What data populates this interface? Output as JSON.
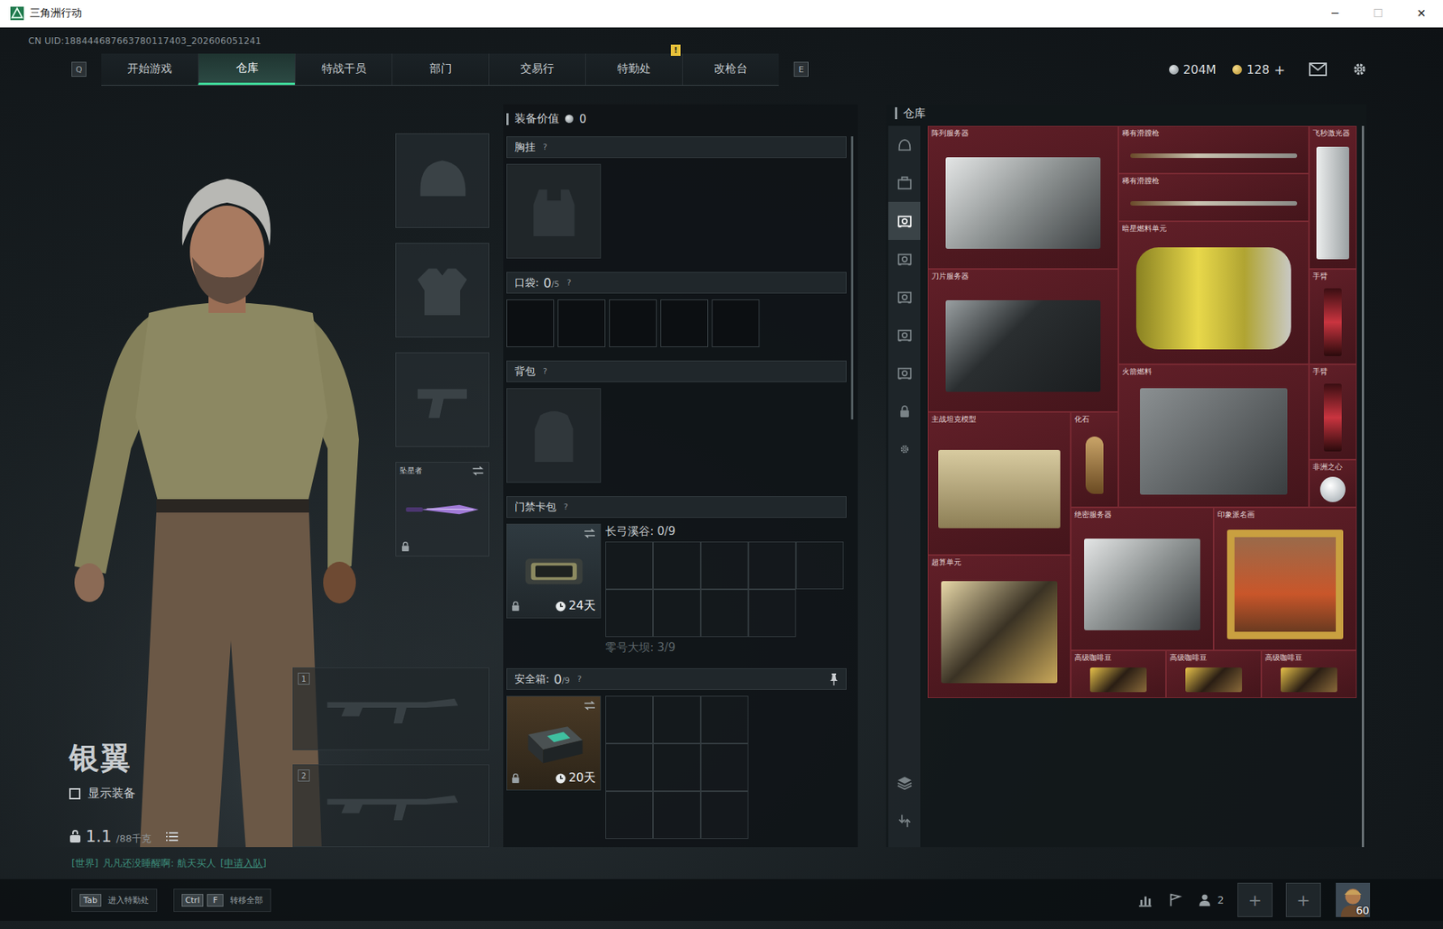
{
  "window": {
    "title": "三角洲行动",
    "controls": [
      "─",
      "☐",
      "✕"
    ]
  },
  "uid": "CN UID:188444687663780117403_202606051241",
  "nav": {
    "prev_key": "Q",
    "next_key": "E",
    "tabs": [
      {
        "label": "开始游戏",
        "selected": false
      },
      {
        "label": "仓库",
        "selected": true
      },
      {
        "label": "特战干员",
        "selected": false
      },
      {
        "label": "部门",
        "selected": false
      },
      {
        "label": "交易行",
        "selected": false
      },
      {
        "label": "特勤处",
        "selected": false,
        "badge": "!"
      },
      {
        "label": "改枪台",
        "selected": false
      }
    ]
  },
  "currency": [
    {
      "kind": "silver",
      "amount": "204M"
    },
    {
      "kind": "gold",
      "amount": "128",
      "action": "+"
    }
  ],
  "operator": {
    "name": "银翼",
    "show_gear": {
      "label": "显示装备",
      "checked": false
    },
    "weight": "1.1",
    "capacity": "/88千克"
  },
  "equipment": [
    {
      "kind": "helmet"
    },
    {
      "kind": "armor"
    },
    {
      "kind": "pistol"
    },
    {
      "kind": "melee",
      "label": "坠星者",
      "locked": true
    }
  ],
  "weapons": [
    {
      "number": "1"
    },
    {
      "number": "2"
    }
  ],
  "loadout": {
    "value_label": "装备价值",
    "value": "0",
    "chest_rig": {
      "title": "胸挂",
      "help": "?"
    },
    "pockets": {
      "title": "口袋:",
      "count": "0",
      "capacity": "/5",
      "help": "?",
      "slots": [
        {
          "filled": false
        },
        {
          "filled": false
        },
        {
          "filled": false
        },
        {
          "filled": false
        },
        {
          "filled": false
        }
      ]
    },
    "backpack": {
      "title": "背包",
      "help": "?"
    },
    "keycard": {
      "title": "门禁卡包",
      "help": "?",
      "item": {
        "time": "24天",
        "locked": true
      },
      "maps": [
        {
          "label": "长弓溪谷: 0/9",
          "active": true
        },
        {
          "label": "零号大坝: 3/9",
          "active": false
        }
      ],
      "grid": [
        {
          "filled": false
        },
        {
          "filled": false
        },
        {
          "filled": false
        },
        {
          "filled": false
        },
        {
          "filled": false
        },
        {
          "filled": false
        },
        {
          "filled": false
        },
        {
          "filled": false
        },
        {
          "filled": false
        }
      ]
    },
    "safebox": {
      "title": "安全箱:",
      "count": "0",
      "capacity": "/9",
      "help": "?",
      "item": {
        "time": "20天",
        "locked": true
      },
      "grid": [
        {
          "filled": false
        },
        {
          "filled": false
        },
        {
          "filled": false
        },
        {
          "filled": false
        },
        {
          "filled": false
        },
        {
          "filled": false
        },
        {
          "filled": false
        },
        {
          "filled": false
        },
        {
          "filled": false
        }
      ]
    }
  },
  "warehouse": {
    "title": "仓库",
    "side_tabs": [
      {
        "kind": "all",
        "selected": false
      },
      {
        "kind": "case",
        "selected": false
      },
      {
        "kind": "storage",
        "selected": true
      },
      {
        "kind": "storage",
        "selected": false
      },
      {
        "kind": "storage",
        "selected": false
      },
      {
        "kind": "storage",
        "selected": false
      },
      {
        "kind": "storage",
        "selected": false
      },
      {
        "kind": "locked",
        "selected": false
      },
      {
        "kind": "settings",
        "selected": false
      }
    ],
    "tools": [
      {
        "kind": "stack"
      },
      {
        "kind": "transfer"
      }
    ],
    "items": [
      {
        "name": "阵列服务器"
      },
      {
        "name": "稀有滑膛枪"
      },
      {
        "name": "稀有滑膛枪"
      },
      {
        "name": "飞秒激光器"
      },
      {
        "name": "暗星燃料单元"
      },
      {
        "name": "刀片服务器"
      },
      {
        "name": "手臂"
      },
      {
        "name": "手臂"
      },
      {
        "name": "火箭燃料"
      },
      {
        "name": "主战坦克模型"
      },
      {
        "name": "化石"
      },
      {
        "name": "非洲之心"
      },
      {
        "name": "绝密服务器"
      },
      {
        "name": "印象派名画"
      },
      {
        "name": "超算单元"
      },
      {
        "name": "高级咖啡豆"
      },
      {
        "name": "高级咖啡豆"
      },
      {
        "name": "高级咖啡豆"
      }
    ]
  },
  "chat": {
    "channel": "[世界]",
    "message": "凡凡还没睡醒啊: 航天买人",
    "action": "[申请入队]"
  },
  "bottom_bar": {
    "hints": [
      {
        "keys": [
          "Tab"
        ],
        "label": "进入特勤处"
      },
      {
        "keys": [
          "Ctrl",
          "F"
        ],
        "label": "转移全部"
      }
    ],
    "squad_count": "2",
    "slots": [
      "+",
      "+"
    ],
    "level": "60"
  }
}
